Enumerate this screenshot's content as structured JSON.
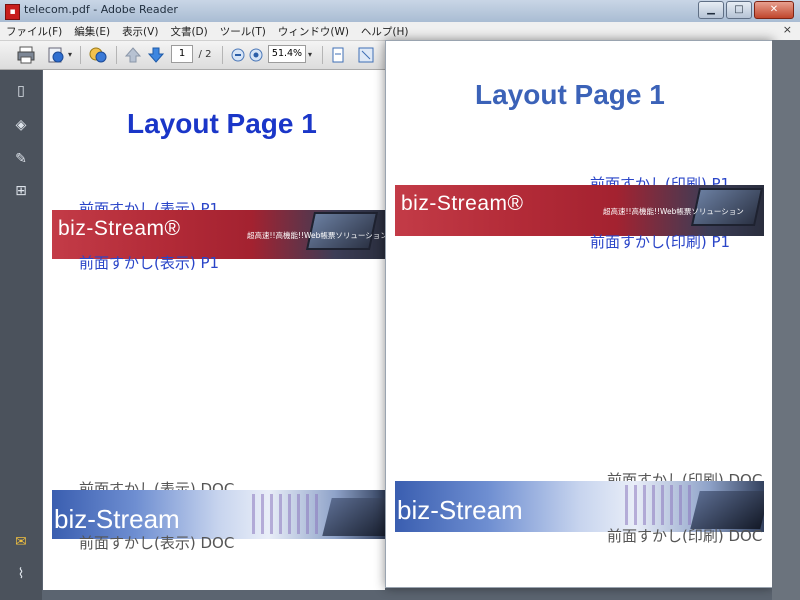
{
  "window": {
    "title": "telecom.pdf - Adobe Reader",
    "app_icon": "pdf-icon"
  },
  "menu": [
    "ファイル(F)",
    "編集(E)",
    "表示(V)",
    "文書(D)",
    "ツール(T)",
    "ウィンドウ(W)",
    "ヘルプ(H)"
  ],
  "menu_close": "×",
  "toolbar": {
    "current_page": "1",
    "page_total": "/ 2",
    "zoom": "51.4%"
  },
  "page1": {
    "title": "Layout Page 1",
    "front_watermark_top": "前面すかし(表示) P1",
    "front_watermark_bottom": "前面すかし(表示) P1",
    "doc_watermark_top": "前面すかし(表示) DOC",
    "doc_watermark_bottom": "前面すかし(表示) DOC"
  },
  "page2": {
    "title": "Layout Page 1",
    "front_watermark_top": "前面すかし(印刷) P1",
    "front_watermark_bottom": "前面すかし(印刷) P1",
    "doc_watermark_top": "前面すかし(印刷) DOC",
    "doc_watermark_bottom": "前面すかし(印刷) DOC"
  },
  "banner": {
    "logo": "biz-Stream®",
    "logo_plain": "biz-Stream",
    "tagline": "超高速!!高機能!!Web帳票ソリューション"
  },
  "colors": {
    "title_blue_page1": "#1a36c8",
    "title_blue_page2": "#3b62b8",
    "watermark_blue": "#2a45c8",
    "watermark_gray": "#555555"
  }
}
